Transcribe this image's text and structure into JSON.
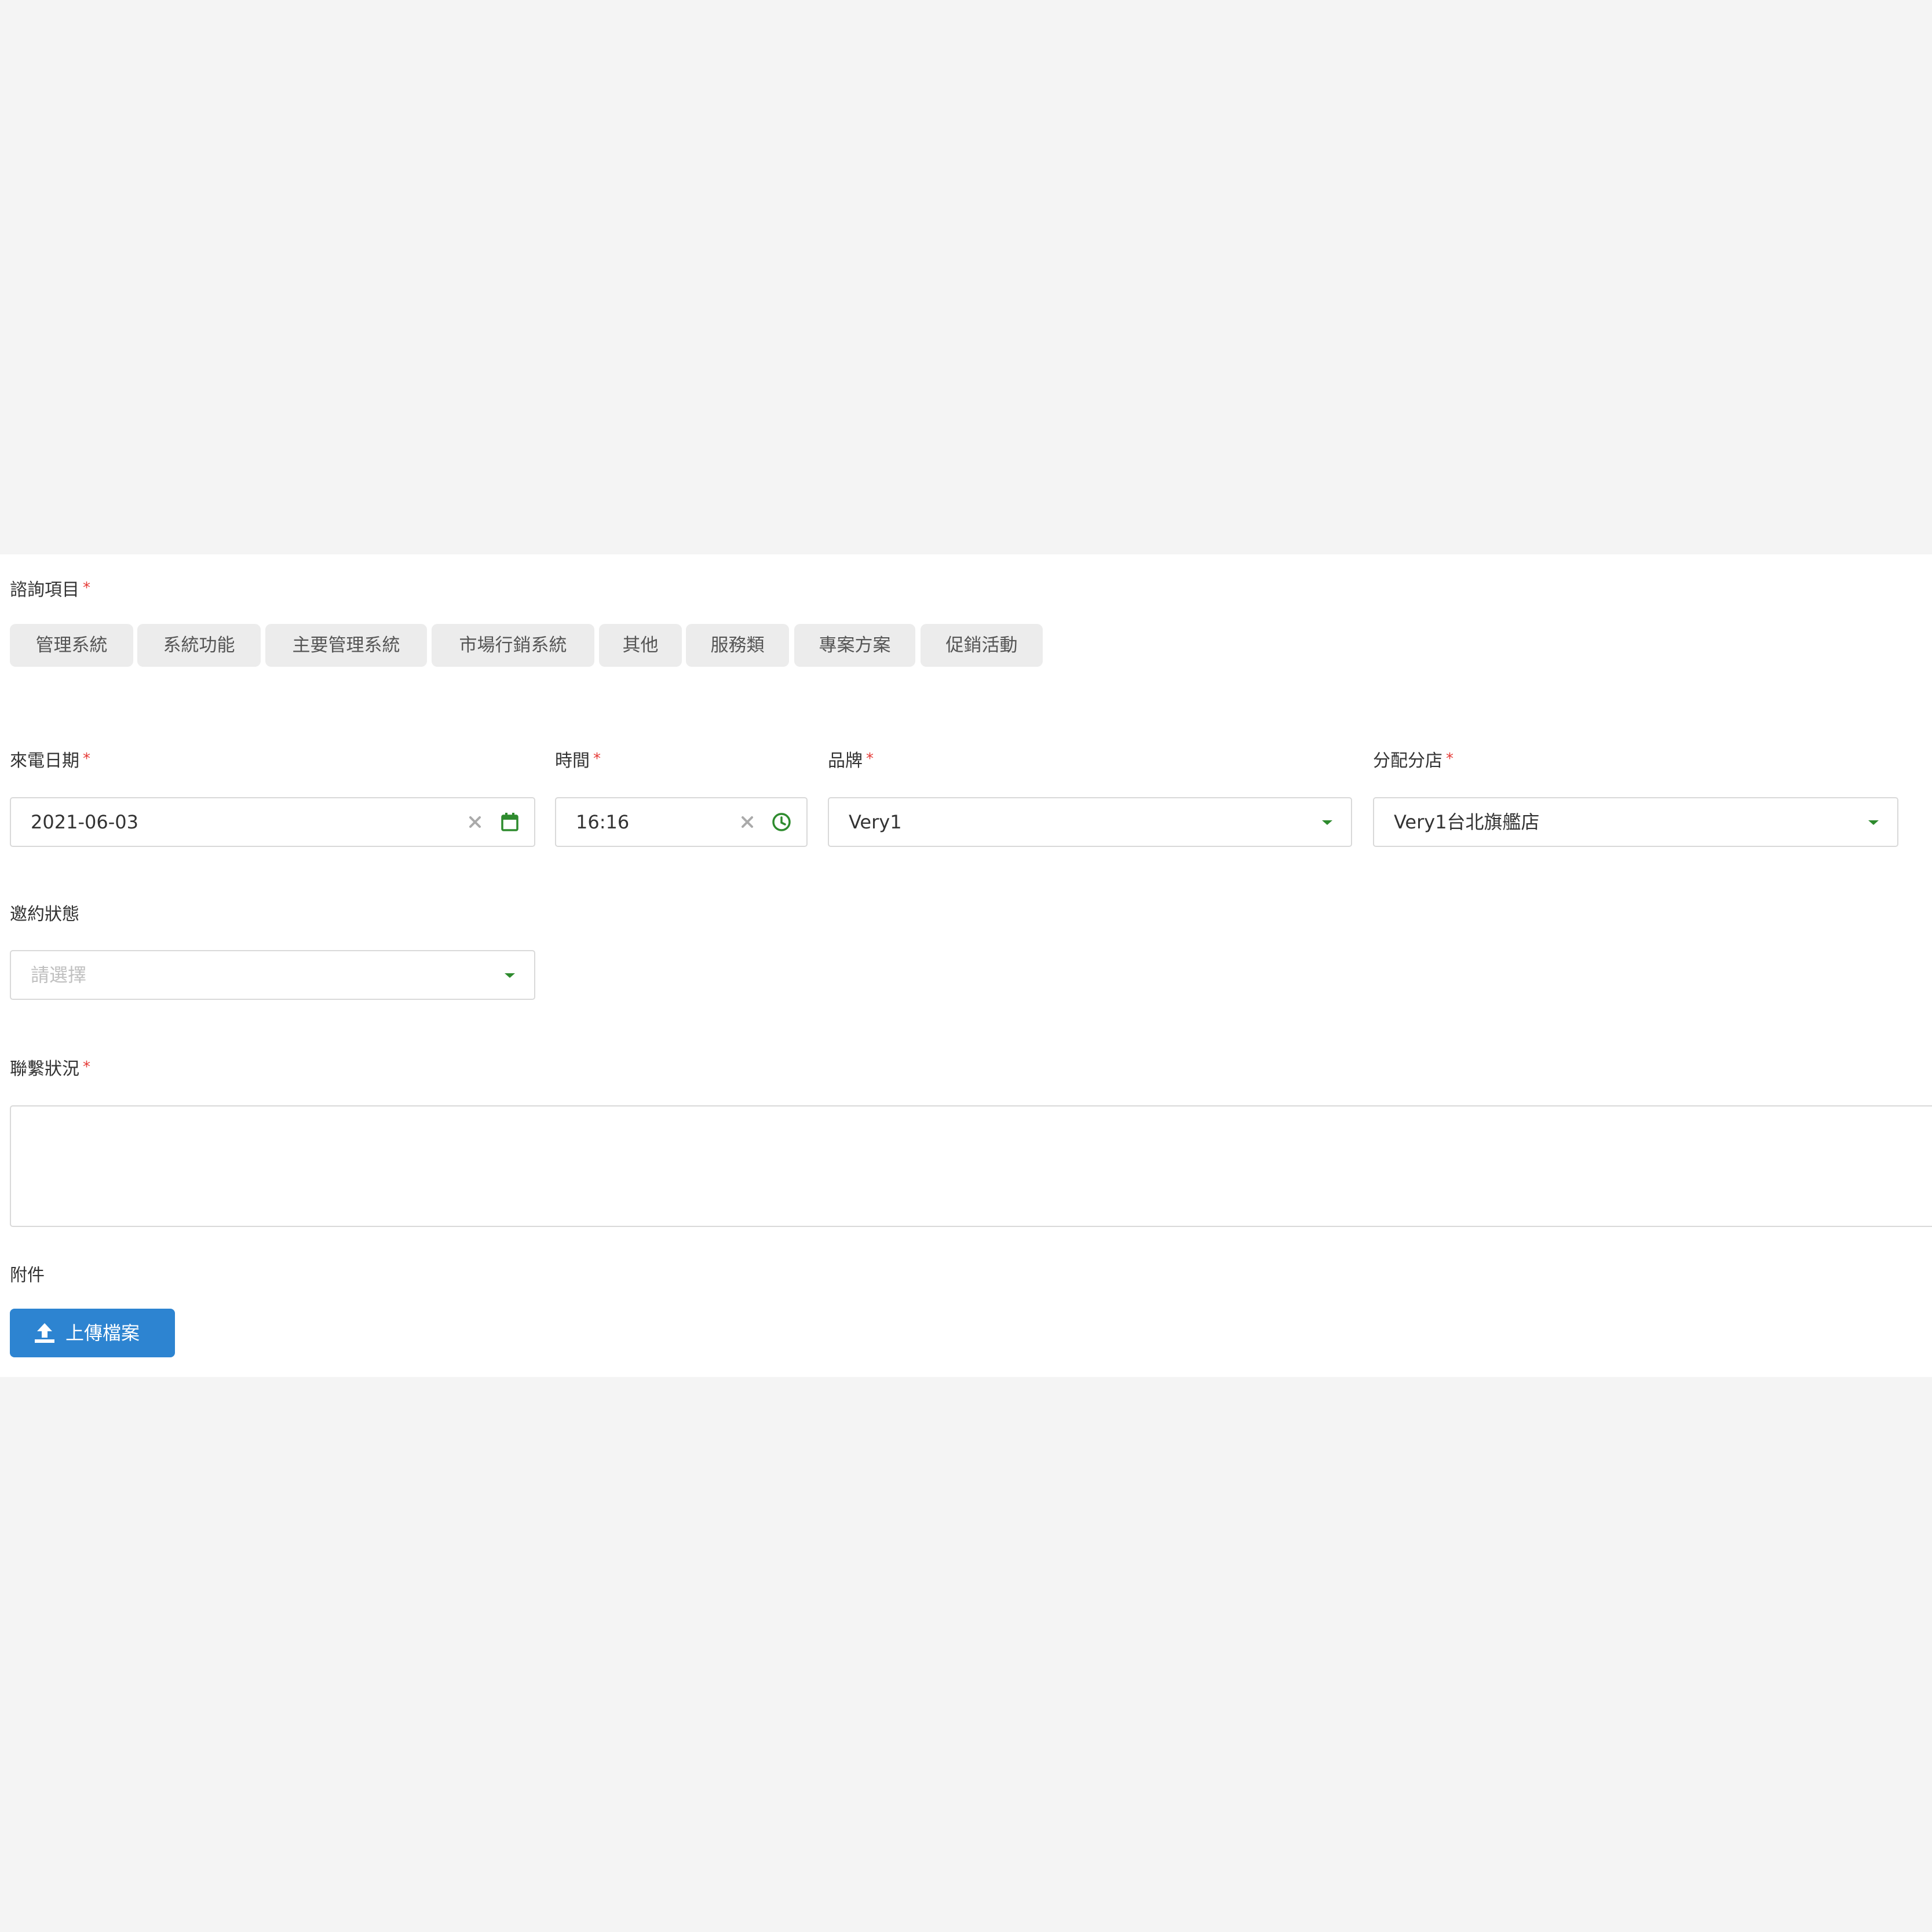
{
  "form": {
    "inquiry": {
      "label": "諮詢項目",
      "required_mark": "*",
      "tags": [
        "管理系統",
        "系統功能",
        "主要管理系統",
        "市場行銷系統",
        "其他",
        "服務類",
        "專案方案",
        "促銷活動"
      ]
    },
    "call_date": {
      "label": "來電日期",
      "required_mark": "*",
      "value": "2021-06-03",
      "icons": [
        "clear-icon",
        "calendar-icon"
      ]
    },
    "time": {
      "label": "時間",
      "required_mark": "*",
      "value": "16:16",
      "icons": [
        "clear-icon",
        "clock-icon"
      ]
    },
    "brand": {
      "label": "品牌",
      "required_mark": "*",
      "value": "Very1",
      "icon": "caret-down-icon"
    },
    "branch": {
      "label": "分配分店",
      "required_mark": "*",
      "value": "Very1台北旗艦店",
      "icon": "caret-down-icon"
    },
    "invite_status": {
      "label": "邀約狀態",
      "placeholder": "請選擇",
      "icon": "caret-down-icon"
    },
    "contact_status": {
      "label": "聯繫狀況",
      "required_mark": "*",
      "value": ""
    },
    "attachment": {
      "label": "附件",
      "upload_button": "上傳檔案",
      "icon": "upload-icon"
    }
  },
  "colors": {
    "page_background": "#f4f4f4",
    "panel_background": "#ffffff",
    "required": "#e53935",
    "tag_background": "#ececec",
    "icon_green": "#2e8b2e",
    "icon_gray": "#aaaaaa",
    "button_blue": "#2d84d1",
    "border": "#d9d9d9"
  }
}
